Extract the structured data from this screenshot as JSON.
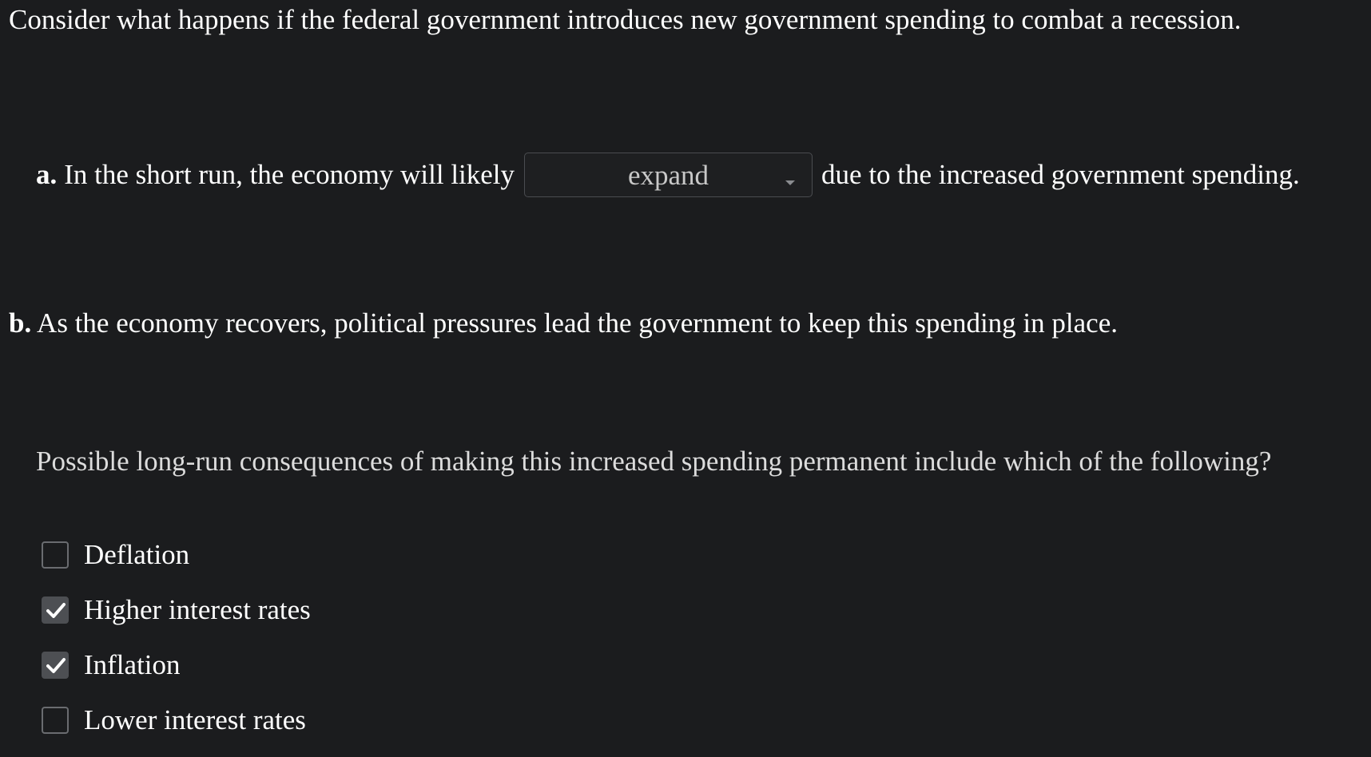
{
  "intro": "Consider what happens if the federal government introduces new government spending to combat a recession.",
  "part_a": {
    "label": "a.",
    "before_text": "In the short run, the economy will likely",
    "selected_value": "expand",
    "after_text": "due to the increased government spending."
  },
  "part_b": {
    "label": "b.",
    "text": "As the economy recovers, political pressures lead the government to keep this spending in place."
  },
  "question": "Possible long-run consequences of making this increased spending permanent include which of the following?",
  "options": [
    {
      "label": "Deflation",
      "checked": false
    },
    {
      "label": "Higher interest rates",
      "checked": true
    },
    {
      "label": "Inflation",
      "checked": true
    },
    {
      "label": "Lower interest rates",
      "checked": false
    }
  ],
  "colors": {
    "background": "#1b1c1e",
    "text": "#ffffff",
    "checked_fill": "#4d4f53",
    "checkbox_border": "#6a6c70"
  },
  "icons": {
    "checkmark": "check-icon",
    "dropdown": "caret-down-icon"
  }
}
